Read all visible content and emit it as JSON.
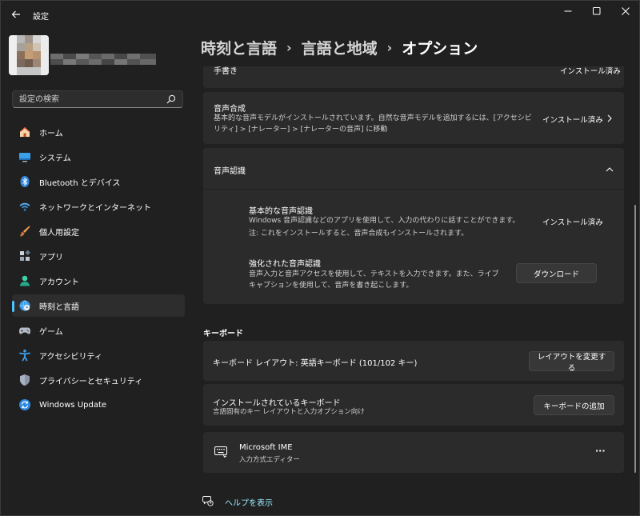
{
  "window": {
    "title": "設定",
    "back_icon": "arrow-left-icon",
    "controls": [
      "minimize-icon",
      "maximize-icon",
      "close-icon"
    ]
  },
  "sidebar": {
    "search": {
      "placeholder": "設定の検索",
      "value": ""
    },
    "items": [
      {
        "label": "ホーム",
        "icon": "home-icon"
      },
      {
        "label": "システム",
        "icon": "monitor-icon"
      },
      {
        "label": "Bluetooth とデバイス",
        "icon": "bluetooth-icon"
      },
      {
        "label": "ネットワークとインターネット",
        "icon": "wifi-icon"
      },
      {
        "label": "個人用設定",
        "icon": "brush-icon"
      },
      {
        "label": "アプリ",
        "icon": "apps-icon"
      },
      {
        "label": "アカウント",
        "icon": "person-icon"
      },
      {
        "label": "時刻と言語",
        "icon": "globe-clock-icon",
        "active": true
      },
      {
        "label": "ゲーム",
        "icon": "gamepad-icon"
      },
      {
        "label": "アクセシビリティ",
        "icon": "accessibility-icon"
      },
      {
        "label": "プライバシーとセキュリティ",
        "icon": "shield-icon"
      },
      {
        "label": "Windows Update",
        "icon": "sync-icon"
      }
    ]
  },
  "breadcrumb": [
    "時刻と言語",
    "言語と地域",
    "オプション"
  ],
  "content": {
    "handwriting": {
      "title": "手書き",
      "status": "インストール済み"
    },
    "speech_synthesis": {
      "title": "音声合成",
      "desc_line1": "基本的な音声モデルがインストールされています。自然な音声モデルを追加するには、[アクセシビ",
      "desc_line2": "リティ] > [ナレーター] > [ナレーターの音声] に移動",
      "status": "インストール済み"
    },
    "speech_recognition": {
      "title": "音声認識",
      "basic": {
        "title": "基本的な音声認識",
        "desc_line1": "Windows 音声認識などのアプリを使用して、入力の代わりに話すことができます。",
        "desc_line2": "注: これをインストールすると、音声合成もインストールされます。",
        "status": "インストール済み"
      },
      "enhanced": {
        "title": "強化された音声認識",
        "desc_line1": "音声入力と音声アクセスを使用して、テキストを入力できます。また、ライブ",
        "desc_line2": "キャプションを使用して、音声を書き起こします。",
        "button": "ダウンロード"
      }
    },
    "keyboard": {
      "section_title": "キーボード",
      "layout": {
        "title": "キーボード レイアウト: 英語キーボード (101/102 キー)",
        "button": "レイアウトを変更する"
      },
      "installed": {
        "title": "インストールされているキーボード",
        "desc": "言語固有のキー レイアウトと入力オプション向け",
        "button": "キーボードの追加"
      },
      "ime": {
        "title": "Microsoft IME",
        "desc": "入力方式エディター",
        "more": "···"
      }
    },
    "help": {
      "label": "ヘルプを表示"
    }
  },
  "colors": {
    "accent": "#4cc2ff",
    "link": "#99ebff",
    "card": "#2b2b2b",
    "background": "#202020"
  }
}
